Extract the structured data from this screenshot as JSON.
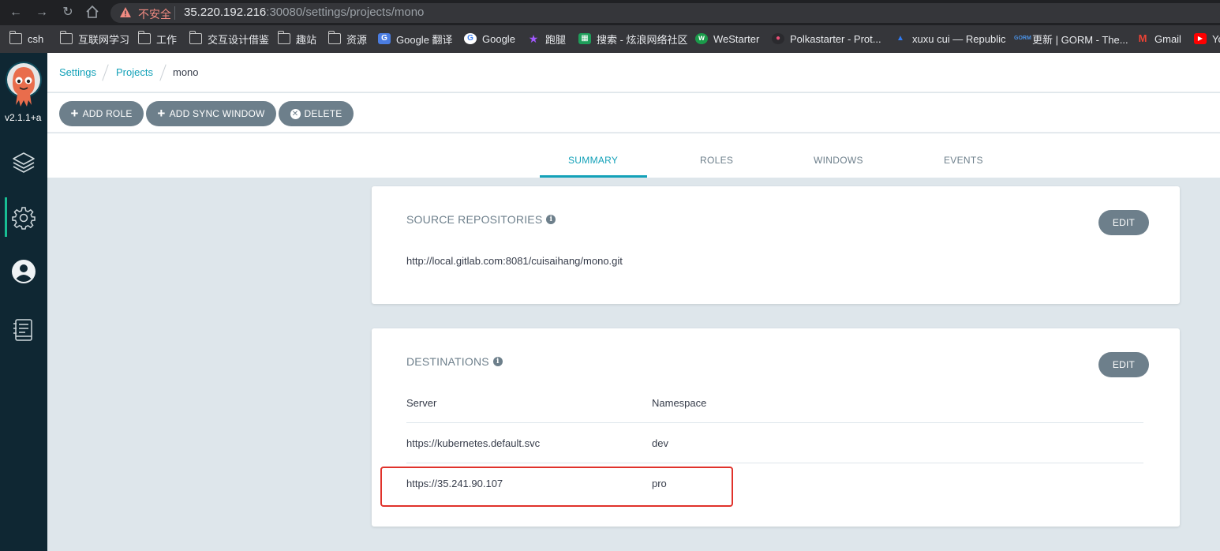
{
  "browser": {
    "insecure_label": "不安全",
    "url_host": "35.220.192.216",
    "url_path": ":30080/settings/projects/mono",
    "bookmarks": [
      {
        "label": "csh",
        "icon": "folder-icon"
      },
      {
        "label": "互联网学习",
        "icon": "folder-icon"
      },
      {
        "label": "工作",
        "icon": "folder-icon"
      },
      {
        "label": "交互设计借鉴",
        "icon": "folder-icon"
      },
      {
        "label": "趣站",
        "icon": "folder-icon"
      },
      {
        "label": "资源",
        "icon": "folder-icon"
      },
      {
        "label": "Google 翻译",
        "icon": "google-translate-icon"
      },
      {
        "label": "Google",
        "icon": "google-icon"
      },
      {
        "label": "跑腿",
        "icon": "star-icon"
      },
      {
        "label": "搜索 - 炫浪网络社区",
        "icon": "site-icon"
      },
      {
        "label": "WeStarter",
        "icon": "westarter-icon"
      },
      {
        "label": "Polkastarter - Prot...",
        "icon": "polkastarter-icon"
      },
      {
        "label": "xuxu cui — Republic",
        "icon": "republic-icon"
      },
      {
        "label": "更新 | GORM - The...",
        "icon": "gorm-icon"
      },
      {
        "label": "Gmail",
        "icon": "gmail-icon"
      },
      {
        "label": "Yo",
        "icon": "youtube-icon"
      }
    ]
  },
  "sidebar": {
    "version": "v2.1.1+a",
    "items": [
      {
        "icon": "layers-icon"
      },
      {
        "icon": "gear-icon"
      },
      {
        "icon": "user-icon"
      },
      {
        "icon": "docs-icon"
      }
    ]
  },
  "breadcrumb": {
    "settings": "Settings",
    "projects": "Projects",
    "current": "mono"
  },
  "toolbar": {
    "add_role": "ADD ROLE",
    "add_sync_window": "ADD SYNC WINDOW",
    "delete": "DELETE"
  },
  "tabs": {
    "summary": "SUMMARY",
    "roles": "ROLES",
    "windows": "WINDOWS",
    "events": "EVENTS",
    "active": "SUMMARY"
  },
  "source_repos": {
    "title": "SOURCE REPOSITORIES",
    "edit": "EDIT",
    "repos": [
      "http://local.gitlab.com:8081/cuisaihang/mono.git"
    ]
  },
  "destinations": {
    "title": "DESTINATIONS",
    "edit": "EDIT",
    "header_server": "Server",
    "header_namespace": "Namespace",
    "rows": [
      {
        "server": "https://kubernetes.default.svc",
        "namespace": "dev"
      },
      {
        "server": "https://35.241.90.107",
        "namespace": "pro"
      }
    ]
  },
  "colors": {
    "accent": "#13a1b8",
    "button": "#6d7f8b",
    "sidebar": "#0f2733",
    "highlight": "#e0322b"
  }
}
